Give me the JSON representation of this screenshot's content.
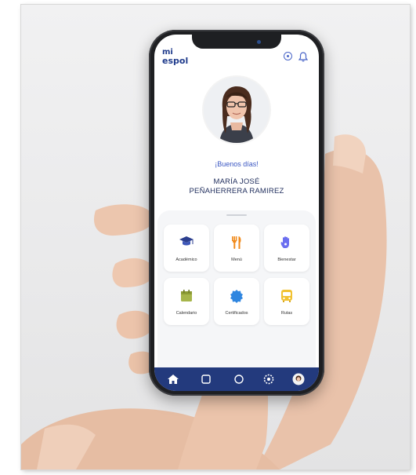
{
  "app": {
    "logo_line1": "mi",
    "logo_line2": "espol"
  },
  "header_icons": [
    "settings-icon",
    "bell-icon"
  ],
  "profile": {
    "greeting": "¡Buenos días!",
    "name_line1": "MARÍA JOSÉ",
    "name_line2": "PEÑAHERRERA RAMIREZ"
  },
  "tiles": [
    {
      "label": "Académico",
      "icon": "graduation-cap-icon"
    },
    {
      "label": "Menú",
      "icon": "utensils-icon"
    },
    {
      "label": "Bienestar",
      "icon": "hand-icon"
    },
    {
      "label": "Calendario",
      "icon": "calendar-icon"
    },
    {
      "label": "Certificados",
      "icon": "badge-icon"
    },
    {
      "label": "Rutas",
      "icon": "bus-icon"
    }
  ],
  "bottom_nav": [
    "home-icon",
    "nav-icon-2",
    "nav-icon-3",
    "settings-icon",
    "profile-avatar-icon"
  ],
  "colors": {
    "brand_blue": "#1f3b8c",
    "nav_bar": "#233a7d",
    "accent_blue": "#3a56c2",
    "tile_orange": "#f18a1b",
    "tile_yellow": "#f1c232",
    "tile_green": "#a6b54a",
    "tile_purple": "#6b6ef0"
  }
}
